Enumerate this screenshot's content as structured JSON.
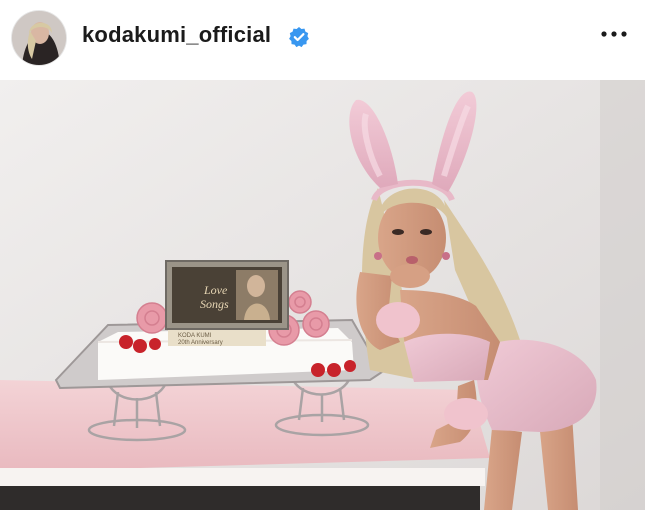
{
  "post": {
    "username": "kodakumi_official",
    "verified": true,
    "menu_icon": "more-horizontal-icon"
  },
  "photo": {
    "plaque_line1": "Love",
    "plaque_line2": "Songs",
    "plaque_caption1": "KODA KUMI",
    "plaque_caption2": "20th Anniversary"
  },
  "colors": {
    "verified_badge": "#3897f0",
    "text": "#1b1b1b",
    "wall": "#ece9e8",
    "table_cloth": "#f1c9cc",
    "outfit": "#e8bcc8"
  }
}
